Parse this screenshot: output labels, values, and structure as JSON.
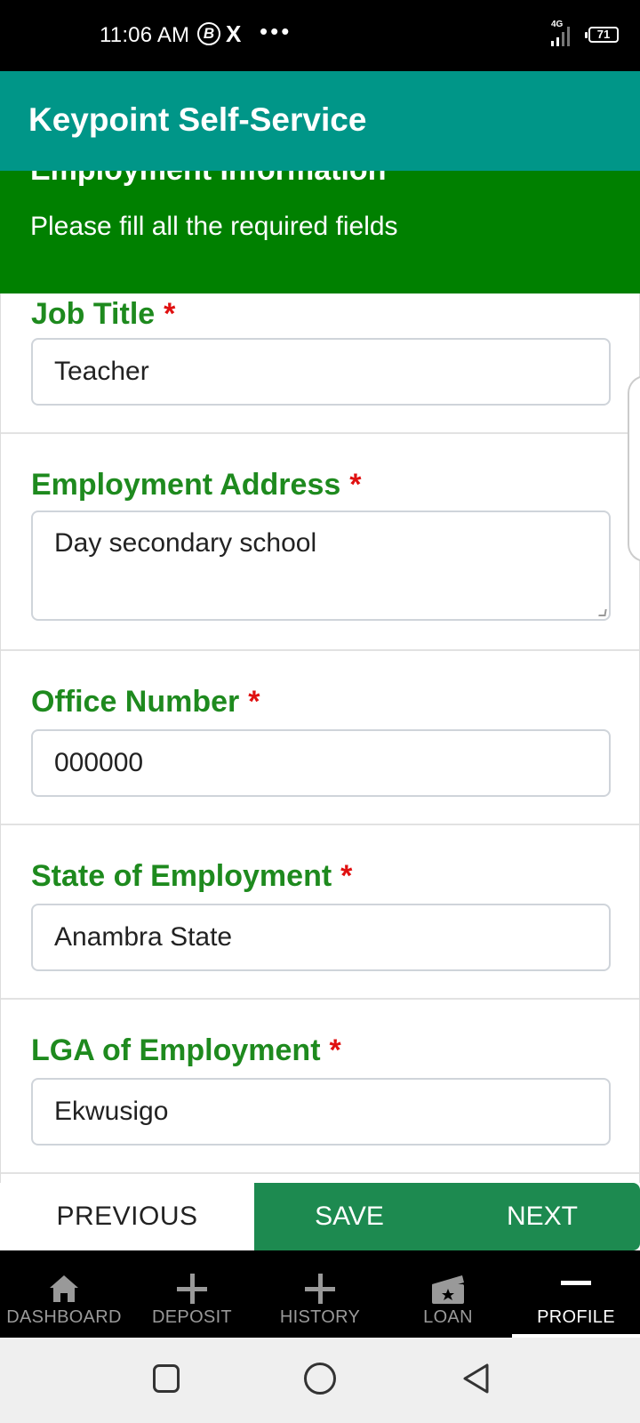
{
  "status_bar": {
    "time": "11:06 AM",
    "b_icon": "B",
    "x_icon": "X",
    "dots": "•••",
    "network": "4G",
    "battery": "71"
  },
  "app_bar": {
    "title": "Keypoint Self-Service"
  },
  "banner": {
    "heading": "Employment Information",
    "subtitle": "Please fill all the required fields"
  },
  "form": {
    "required_mark": "*",
    "fields": [
      {
        "label": "Job Title",
        "value": "Teacher"
      },
      {
        "label": "Employment Address",
        "value": "Day secondary school"
      },
      {
        "label": "Office Number",
        "value": "000000"
      },
      {
        "label": "State of Employment",
        "value": "Anambra State"
      },
      {
        "label": "LGA of Employment",
        "value": "Ekwusigo"
      }
    ]
  },
  "actions": {
    "previous": "PREVIOUS",
    "save": "SAVE",
    "next": "NEXT"
  },
  "bottom_nav": {
    "items": [
      {
        "label": "DASHBOARD",
        "icon": "home-icon"
      },
      {
        "label": "DEPOSIT",
        "icon": "plus-icon"
      },
      {
        "label": "HISTORY",
        "icon": "plus-icon"
      },
      {
        "label": "LOAN",
        "icon": "loan-card-icon"
      },
      {
        "label": "PROFILE",
        "icon": "minus-icon"
      }
    ],
    "active": "PROFILE"
  },
  "colors": {
    "app_bar": "#009688",
    "banner": "#008000",
    "label": "#1e8a1e",
    "required": "#e01010",
    "action_green": "#1d8a50"
  }
}
